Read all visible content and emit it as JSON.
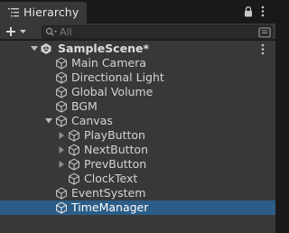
{
  "panel": {
    "tab_title": "Hierarchy",
    "icons": [
      "hierarchy-list-icon",
      "lock-icon",
      "kebab-menu-icon"
    ]
  },
  "toolbar": {
    "add_label": "+",
    "search_placeholder": "All"
  },
  "scene": {
    "name": "SampleScene*"
  },
  "items": [
    {
      "label": "Main Camera"
    },
    {
      "label": "Directional Light"
    },
    {
      "label": "Global Volume"
    },
    {
      "label": "BGM"
    },
    {
      "label": "Canvas",
      "expanded": true
    },
    {
      "label": "PlayButton",
      "has_children": true
    },
    {
      "label": "NextButton",
      "has_children": true
    },
    {
      "label": "PrevButton",
      "has_children": true
    },
    {
      "label": "ClockText"
    },
    {
      "label": "EventSystem"
    },
    {
      "label": "TimeManager",
      "selected": true
    }
  ],
  "colors": {
    "panel_bg": "#383838",
    "selection": "#2c5d87",
    "text": "#d4d4d4"
  }
}
